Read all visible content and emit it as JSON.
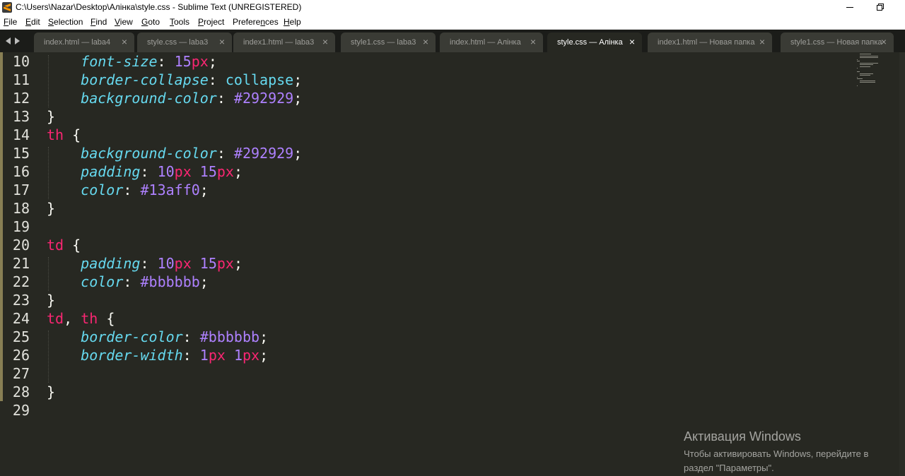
{
  "window": {
    "title": "C:\\Users\\Nazar\\Desktop\\Алінка\\style.css - Sublime Text (UNREGISTERED)"
  },
  "menu": [
    {
      "mnemonic": "F",
      "rest": "ile"
    },
    {
      "mnemonic": "E",
      "rest": "dit"
    },
    {
      "mnemonic": "S",
      "rest": "election"
    },
    {
      "mnemonic": "F",
      "rest": "ind"
    },
    {
      "mnemonic": "V",
      "rest": "iew"
    },
    {
      "mnemonic": "G",
      "rest": "oto"
    },
    {
      "mnemonic": "T",
      "rest": "ools"
    },
    {
      "mnemonic": "P",
      "rest": "roject"
    },
    {
      "mnemonic": "n",
      "pre": "Prefere",
      "rest": "ces"
    },
    {
      "mnemonic": "H",
      "rest": "elp"
    }
  ],
  "tabs": [
    {
      "label": "index.html — laba4",
      "close": "×",
      "active": false
    },
    {
      "label": "style.css — laba3",
      "close": "×",
      "active": false
    },
    {
      "label": "index1.html — laba3",
      "close": "×",
      "active": false
    },
    {
      "label": "style1.css — laba3",
      "close": "×",
      "active": false
    },
    {
      "label": "index.html — Алінка",
      "close": "×",
      "active": false
    },
    {
      "label": "style.css — Алінка",
      "close": "×",
      "active": true
    },
    {
      "label": "index1.html — Новая папка",
      "close": "×",
      "active": false
    },
    {
      "label": "style1.css — Новая папка",
      "close": "×",
      "active": false
    }
  ],
  "code": {
    "lines": [
      {
        "n": "10",
        "text": "    font-size: 15px;"
      },
      {
        "n": "11",
        "text": "    border-collapse: collapse;"
      },
      {
        "n": "12",
        "text": "    background-color: #292929;"
      },
      {
        "n": "13",
        "text": "}"
      },
      {
        "n": "14",
        "text": "th {"
      },
      {
        "n": "15",
        "text": "    background-color: #292929;"
      },
      {
        "n": "16",
        "text": "    padding: 10px 15px;"
      },
      {
        "n": "17",
        "text": "    color: #13aff0;"
      },
      {
        "n": "18",
        "text": "}"
      },
      {
        "n": "19",
        "text": ""
      },
      {
        "n": "20",
        "text": "td {"
      },
      {
        "n": "21",
        "text": "    padding: 10px 15px;"
      },
      {
        "n": "22",
        "text": "    color: #bbbbbb;"
      },
      {
        "n": "23",
        "text": "}"
      },
      {
        "n": "24",
        "text": "td, th {"
      },
      {
        "n": "25",
        "text": "    border-color: #bbbbbb;"
      },
      {
        "n": "26",
        "text": "    border-width: 1px 1px;"
      },
      {
        "n": "27",
        "text": ""
      },
      {
        "n": "28",
        "text": "}"
      },
      {
        "n": "29",
        "text": ""
      }
    ]
  },
  "activation": {
    "title": "Активация Windows",
    "text": "Чтобы активировать Windows, перейдите в раздел \"Параметры\"."
  },
  "colors": {
    "background": "#272822",
    "selector": "#f92672",
    "property": "#66d9ef",
    "number": "#ae81ff",
    "text": "#f8f8f2"
  }
}
